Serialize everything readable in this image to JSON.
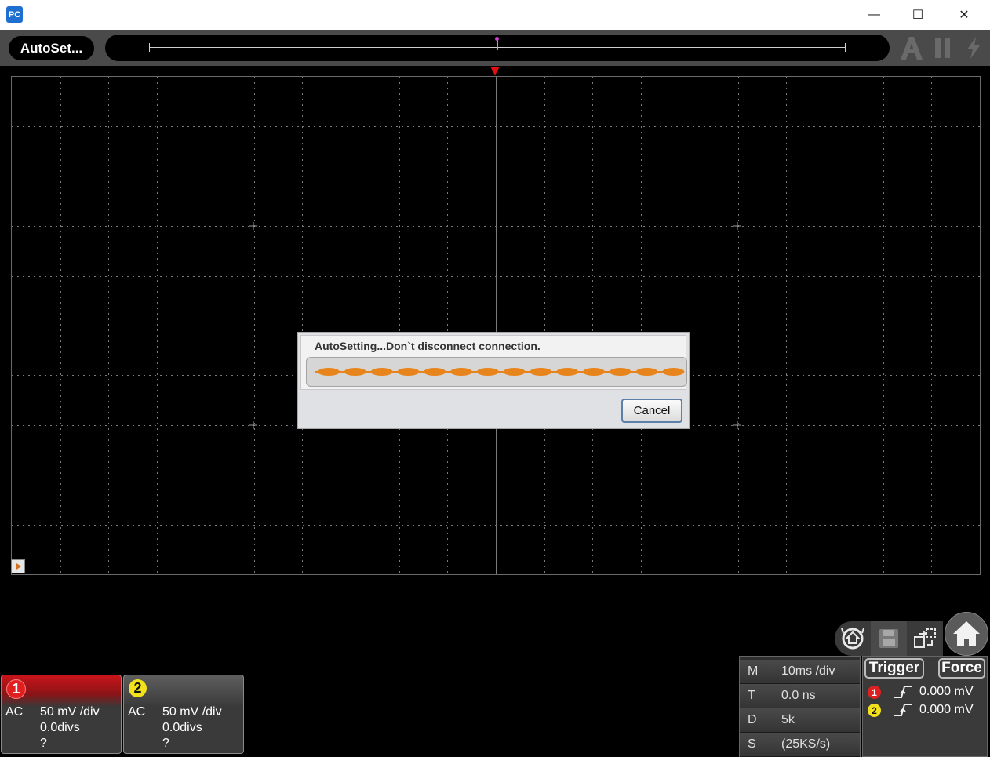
{
  "window": {
    "app_icon_text": "PC",
    "controls": {
      "minimize": "—",
      "maximize": "☐",
      "close": "✕"
    }
  },
  "toolbar": {
    "autoset_label": "AutoSet...",
    "icons": [
      "auto-icon",
      "pause-icon",
      "lightning-icon"
    ]
  },
  "dialog": {
    "message": "AutoSetting...Don`t disconnect connection.",
    "cancel_label": "Cancel",
    "progress_style": "indeterminate"
  },
  "channels": [
    {
      "number": "1",
      "coupling": "AC",
      "scale": "50 mV /div",
      "offset": "0.0divs",
      "probe": "?",
      "color": "#e02020"
    },
    {
      "number": "2",
      "coupling": "AC",
      "scale": "50 mV /div",
      "offset": "0.0divs",
      "probe": "?",
      "color": "#f2e21c"
    }
  ],
  "timebase": {
    "rows": [
      {
        "key": "M",
        "value": "10ms /div"
      },
      {
        "key": "T",
        "value": "0.0 ns"
      },
      {
        "key": "D",
        "value": "5k"
      },
      {
        "key": "S",
        "value": "(25KS/s)"
      }
    ]
  },
  "trigger": {
    "trigger_label": "Trigger",
    "force_label": "Force",
    "channels": [
      {
        "number": "1",
        "edge": "rising",
        "level": "0.000 mV",
        "color": "#e02020"
      },
      {
        "number": "2",
        "edge": "rising",
        "level": "0.000 mV",
        "color": "#f2e21c"
      }
    ]
  },
  "tools": [
    "zoom-home-icon",
    "save-icon",
    "window-switch-icon",
    "home-icon"
  ],
  "colors": {
    "grid": "#7a7a7a",
    "trigger_marker": "#e01010",
    "progress": "#e8841c"
  }
}
